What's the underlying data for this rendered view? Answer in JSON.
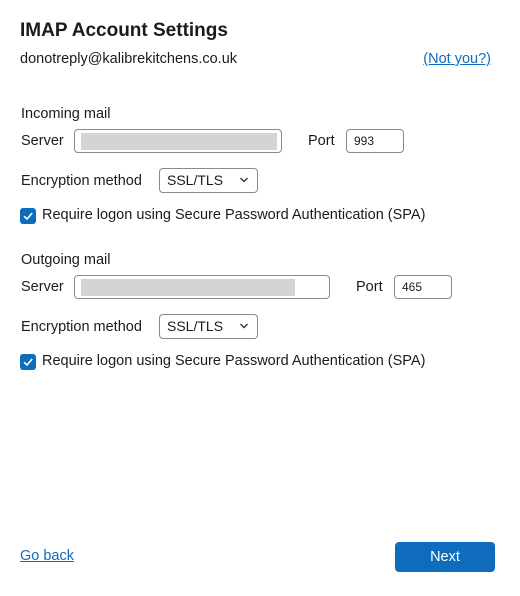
{
  "header": {
    "title": "IMAP Account Settings",
    "email": "donotreply@kalibrekitchens.co.uk",
    "not_you_link": "(Not you?)"
  },
  "incoming": {
    "section_label": "Incoming mail",
    "server_label": "Server",
    "server_value": "",
    "port_label": "Port",
    "port_value": "993",
    "encryption_label": "Encryption method",
    "encryption_value": "SSL/TLS",
    "spa_checked": true,
    "spa_label": "Require logon using Secure Password Authentication (SPA)"
  },
  "outgoing": {
    "section_label": "Outgoing mail",
    "server_label": "Server",
    "server_value": "",
    "port_label": "Port",
    "port_value": "465",
    "encryption_label": "Encryption method",
    "encryption_value": "SSL/TLS",
    "spa_checked": true,
    "spa_label": "Require logon using Secure Password Authentication (SPA)"
  },
  "footer": {
    "go_back_label": "Go back",
    "next_label": "Next"
  },
  "colors": {
    "accent": "#0f6cbd",
    "redacted": "#d4d4d4"
  }
}
